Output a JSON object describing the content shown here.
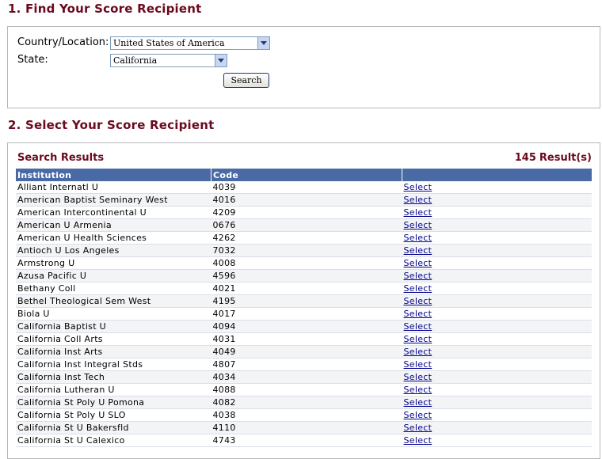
{
  "sections": {
    "find_heading": "1. Find Your Score Recipient",
    "select_heading": "2. Select Your Score Recipient"
  },
  "find": {
    "country_label": "Country/Location:",
    "country_value": "United States of America",
    "state_label": "State:",
    "state_value": "California",
    "search_button": "Search"
  },
  "results": {
    "title": "Search Results",
    "count": "145",
    "count_suffix": "Result(s)",
    "columns": [
      "Institution",
      "Code",
      ""
    ],
    "select_label": "Select",
    "rows": [
      {
        "institution": "Alliant Internatl U",
        "code": "4039"
      },
      {
        "institution": "American Baptist Seminary West",
        "code": "4016"
      },
      {
        "institution": "American Intercontinental U",
        "code": "4209"
      },
      {
        "institution": "American U Armenia",
        "code": "0676"
      },
      {
        "institution": "American U Health Sciences",
        "code": "4262"
      },
      {
        "institution": "Antioch U Los Angeles",
        "code": "7032"
      },
      {
        "institution": "Armstrong U",
        "code": "4008"
      },
      {
        "institution": "Azusa Pacific U",
        "code": "4596"
      },
      {
        "institution": "Bethany Coll",
        "code": "4021"
      },
      {
        "institution": "Bethel Theological Sem West",
        "code": "4195"
      },
      {
        "institution": "Biola U",
        "code": "4017"
      },
      {
        "institution": "California Baptist U",
        "code": "4094"
      },
      {
        "institution": "California Coll Arts",
        "code": "4031"
      },
      {
        "institution": "California Inst Arts",
        "code": "4049"
      },
      {
        "institution": "California Inst Integral Stds",
        "code": "4807"
      },
      {
        "institution": "California Inst Tech",
        "code": "4034"
      },
      {
        "institution": "California Lutheran U",
        "code": "4088"
      },
      {
        "institution": "California St Poly U Pomona",
        "code": "4082"
      },
      {
        "institution": "California St Poly U SLO",
        "code": "4038"
      },
      {
        "institution": "California St U Bakersfld",
        "code": "4110"
      },
      {
        "institution": "California St U Calexico",
        "code": "4743"
      }
    ]
  }
}
